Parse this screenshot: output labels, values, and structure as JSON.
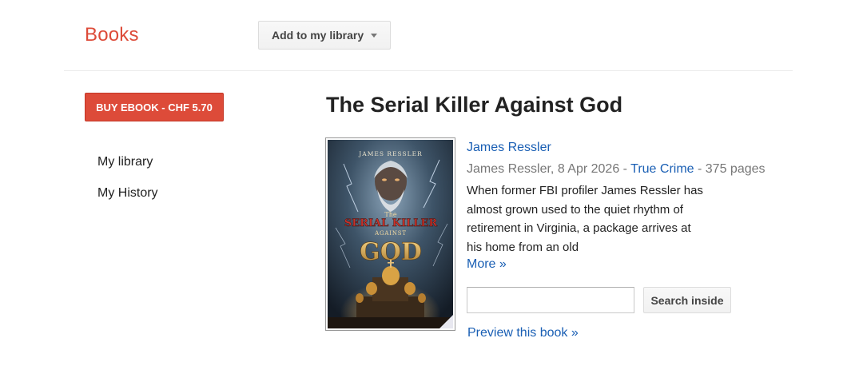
{
  "header": {
    "brand": "Books",
    "add_to_library_label": "Add to my library"
  },
  "sidebar": {
    "buy_label": "BUY EBOOK - CHF 5.70",
    "items": [
      {
        "label": "My library"
      },
      {
        "label": "My History"
      }
    ]
  },
  "book": {
    "title": "The Serial Killer Against God",
    "author": "James Ressler",
    "meta_author_date": "James Ressler, 8 Apr 2026 - ",
    "genre": "True Crime",
    "pages": " - 375 pages",
    "description": "When former FBI profiler James Ressler has almost grown used to the quiet rhythm of retirement in Virginia, a package arrives at his home from an old",
    "more_label": "More »",
    "cover": {
      "author_text": "JAMES RESSLER",
      "line1": "The",
      "line2": "SERIAL KILLER",
      "line3": "AGAINST",
      "line4": "GOD"
    }
  },
  "search": {
    "value": "",
    "placeholder": "",
    "button_label": "Search inside"
  },
  "preview_label": "Preview this book »",
  "colors": {
    "brand": "#dd4b39",
    "link": "#1a5fb4"
  }
}
